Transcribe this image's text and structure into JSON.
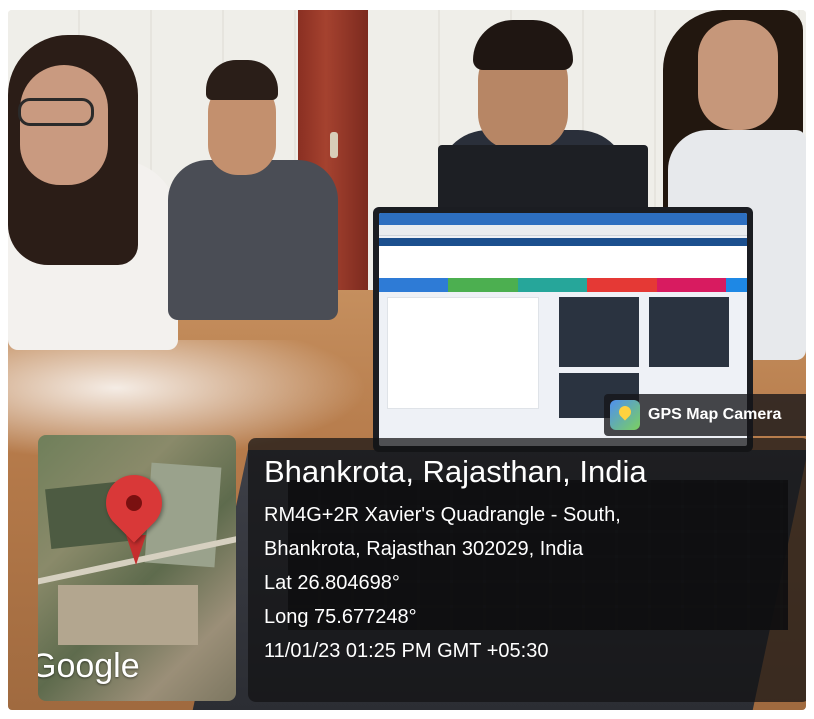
{
  "gps_tag": {
    "label": "GPS Map Camera",
    "icon": "gps-map-camera-app-icon"
  },
  "map": {
    "provider_logo": "Google",
    "pin_color": "#d93838"
  },
  "location": {
    "title": "Bhankrota, Rajasthan, India",
    "address_line1": "RM4G+2R Xavier's Quadrangle - South,",
    "address_line2": "Bhankrota, Rajasthan 302029, India",
    "latitude": "Lat 26.804698°",
    "longitude": "Long 75.677248°",
    "timestamp": "11/01/23 01:25 PM GMT +05:30"
  },
  "colors": {
    "panel_bg": "rgba(18,18,20,0.72)",
    "text": "#ffffff"
  }
}
